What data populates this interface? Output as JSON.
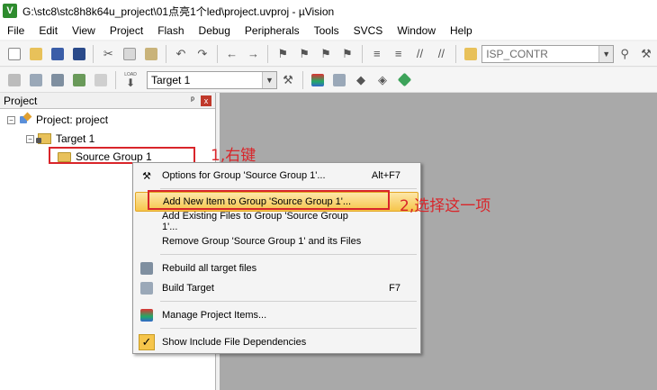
{
  "window": {
    "title": "G:\\stc8\\stc8h8k64u_project\\01点亮1个led\\project.uvproj - µVision",
    "app_icon": "V"
  },
  "menubar": {
    "items": [
      "File",
      "Edit",
      "View",
      "Project",
      "Flash",
      "Debug",
      "Peripherals",
      "Tools",
      "SVCS",
      "Window",
      "Help"
    ]
  },
  "toolbar1": {
    "device_combo": "ISP_CONTR"
  },
  "toolbar2": {
    "load_label": "LOAD",
    "target_combo": "Target 1"
  },
  "project_panel": {
    "title": "Project",
    "pin_glyph": "ᵖ",
    "close_glyph": "x",
    "tree": {
      "root": "Project: project",
      "target": "Target 1",
      "group": "Source Group 1",
      "collapse_glyph": "−"
    }
  },
  "context_menu": {
    "items": [
      {
        "label": "Options for Group 'Source Group 1'...",
        "shortcut": "Alt+F7"
      },
      {
        "label": "Add New  Item to Group 'Source Group 1'...",
        "shortcut": ""
      },
      {
        "label": "Add Existing Files to Group 'Source Group 1'...",
        "shortcut": ""
      },
      {
        "label": "Remove Group 'Source Group 1' and its Files",
        "shortcut": ""
      },
      {
        "label": "Rebuild all target files",
        "shortcut": ""
      },
      {
        "label": "Build Target",
        "shortcut": "F7"
      },
      {
        "label": "Manage Project Items...",
        "shortcut": ""
      },
      {
        "label": "Show Include File Dependencies",
        "shortcut": ""
      }
    ],
    "check_glyph": "✓"
  },
  "annotations": {
    "step1": "1,右键",
    "step2": "2,选择这一项"
  },
  "colors": {
    "annotation_red": "#d9252a",
    "hover_gold": "#f6c54b",
    "workspace_gray": "#a9a9a9"
  }
}
